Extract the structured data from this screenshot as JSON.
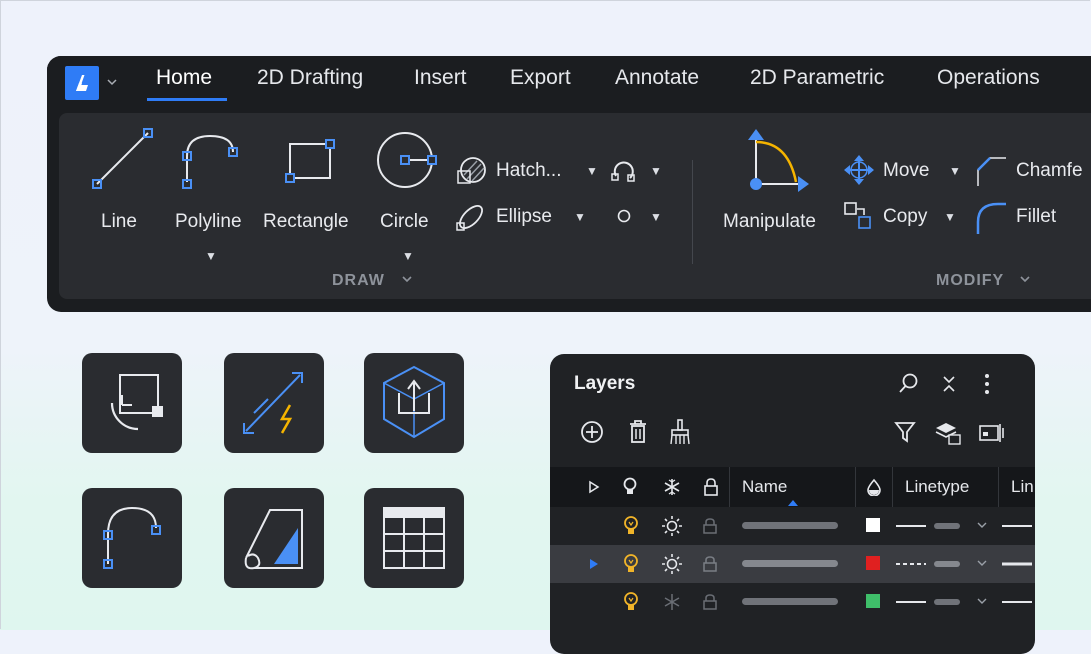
{
  "ribbon": {
    "tabs": [
      "Home",
      "2D Drafting",
      "Insert",
      "Export",
      "Annotate",
      "2D Parametric",
      "Operations"
    ],
    "active_tab": "Home",
    "draw": {
      "section_label": "DRAW",
      "tools": [
        "Line",
        "Polyline",
        "Rectangle",
        "Circle"
      ],
      "hatch_label": "Hatch...",
      "ellipse_label": "Ellipse"
    },
    "modify": {
      "section_label": "MODIFY",
      "manipulate_label": "Manipulate",
      "move_label": "Move",
      "copy_label": "Copy",
      "chamfer_label": "Chamfe",
      "fillet_label": "Fillet"
    },
    "colors": {
      "accent": "#2f7cf6",
      "ribbon_bg": "#1b1d20",
      "panel_bg": "#2a2c30"
    }
  },
  "tiles": [
    "viewport-icon",
    "smart-dimension-icon",
    "3d-box-icon",
    "polyline-arc-icon",
    "sheet-roll-icon",
    "table-icon"
  ],
  "layers_panel": {
    "title": "Layers",
    "columns": {
      "name": "Name",
      "linetype": "Linetype",
      "lineweight": "Lin"
    },
    "rows": [
      {
        "color": "#ffffff",
        "frozen": false,
        "selected": false
      },
      {
        "color": "#e02020",
        "frozen": false,
        "selected": true
      },
      {
        "color": "#3fbf6a",
        "frozen": true,
        "selected": false
      }
    ]
  }
}
